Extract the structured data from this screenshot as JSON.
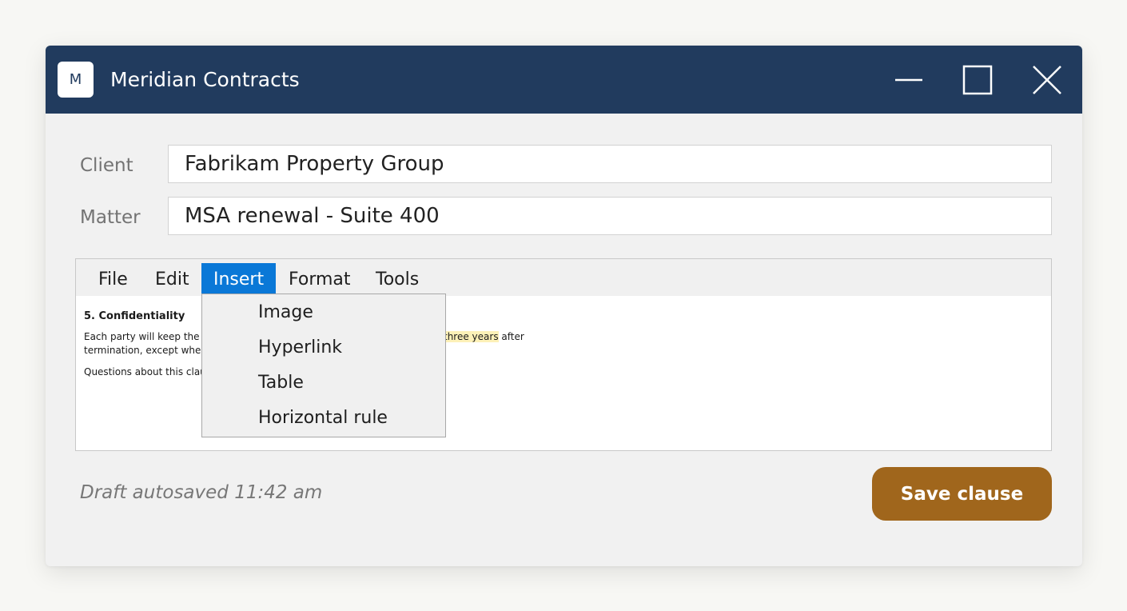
{
  "window": {
    "logo_letter": "M",
    "title": "Meridian Contracts"
  },
  "form": {
    "client_label": "Client",
    "client_value": "Fabrikam Property Group",
    "matter_label": "Matter",
    "matter_value": "MSA renewal - Suite 400"
  },
  "menu": {
    "items": [
      "File",
      "Edit",
      "Insert",
      "Format",
      "Tools"
    ],
    "active": "Insert",
    "insert_dropdown": [
      "Image",
      "Hyperlink",
      "Table",
      "Horizontal rule"
    ]
  },
  "document": {
    "heading": "5. Confidentiality",
    "line1_start": "Each party will keep the ot",
    "line1_highlight": "three years",
    "line1_end": " after",
    "line2": "termination, except where",
    "line3": "Questions about this clause"
  },
  "status": {
    "text": "Draft autosaved 11:42 am"
  },
  "actions": {
    "save_label": "Save clause"
  },
  "colors": {
    "titlebar": "#213b5e",
    "menu_active": "#0a78d7",
    "save_button": "#a0661c",
    "highlight": "#fdf1b8"
  },
  "icons": {
    "minimize": "minimize-icon",
    "maximize": "maximize-icon",
    "close": "close-icon"
  }
}
